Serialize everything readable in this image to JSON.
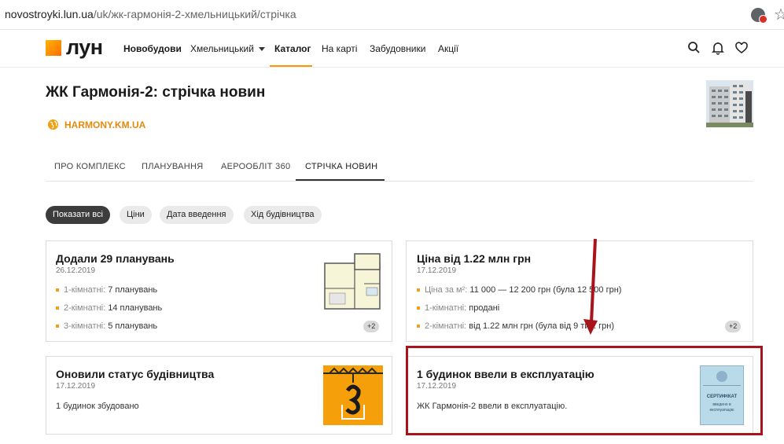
{
  "browser": {
    "url_host": "novostroyki.lun.ua",
    "url_path": "/uk/жк-гармонія-2-хмельницький/стрічка"
  },
  "header": {
    "logo": "ЛУН",
    "nav": {
      "new_buildings": "Новобудови",
      "city": "Хмельницький",
      "catalog": "Каталог",
      "map": "На карті",
      "developers": "Забудовники",
      "promotions": "Акції"
    }
  },
  "page": {
    "title": "ЖК Гармонія-2: стрічка новин",
    "website": "HARMONY.KM.UA"
  },
  "tabs": [
    "ПРО КОМПЛЕКС",
    "ПЛАНУВАННЯ",
    "АЕРООБЛІТ 360",
    "СТРІЧКА НОВИН"
  ],
  "filters": [
    "Показати всі",
    "Ціни",
    "Дата введення",
    "Хід будівництва"
  ],
  "cards": {
    "layouts": {
      "title": "Додали 29 планувань",
      "date": "26.12.2019",
      "lines": [
        {
          "label": "1-кімнатні:",
          "value": "7 планувань"
        },
        {
          "label": "2-кімнатні:",
          "value": "14 планувань"
        },
        {
          "label": "3-кімнатні:",
          "value": "5 планувань"
        }
      ],
      "badge": "+2"
    },
    "price": {
      "title": "Ціна від 1.22 млн грн",
      "date": "17.12.2019",
      "lines": [
        {
          "label": "Ціна за м²:",
          "value": "11 000 — 12 200 грн (була 12 500 грн)"
        },
        {
          "label": "1-кімнатні:",
          "value": "продані"
        },
        {
          "label": "2-кімнатні:",
          "value": "від 1.22 млн грн (була від 9 тис. грн)"
        }
      ],
      "badge": "+2"
    },
    "construction": {
      "title": "Оновили статус будівництва",
      "date": "17.12.2019",
      "text": "1 будинок збудовано"
    },
    "commissioning": {
      "title": "1 будинок ввели в експлуатацію",
      "date": "17.12.2019",
      "text": "ЖК Гармонія-2 ввели в експлуатацію.",
      "cert_title": "СЕРТИФІКАТ",
      "cert_sub": "введено в експлуатацію"
    }
  },
  "colors": {
    "accent": "#ff9800",
    "highlight": "#a8141c"
  }
}
